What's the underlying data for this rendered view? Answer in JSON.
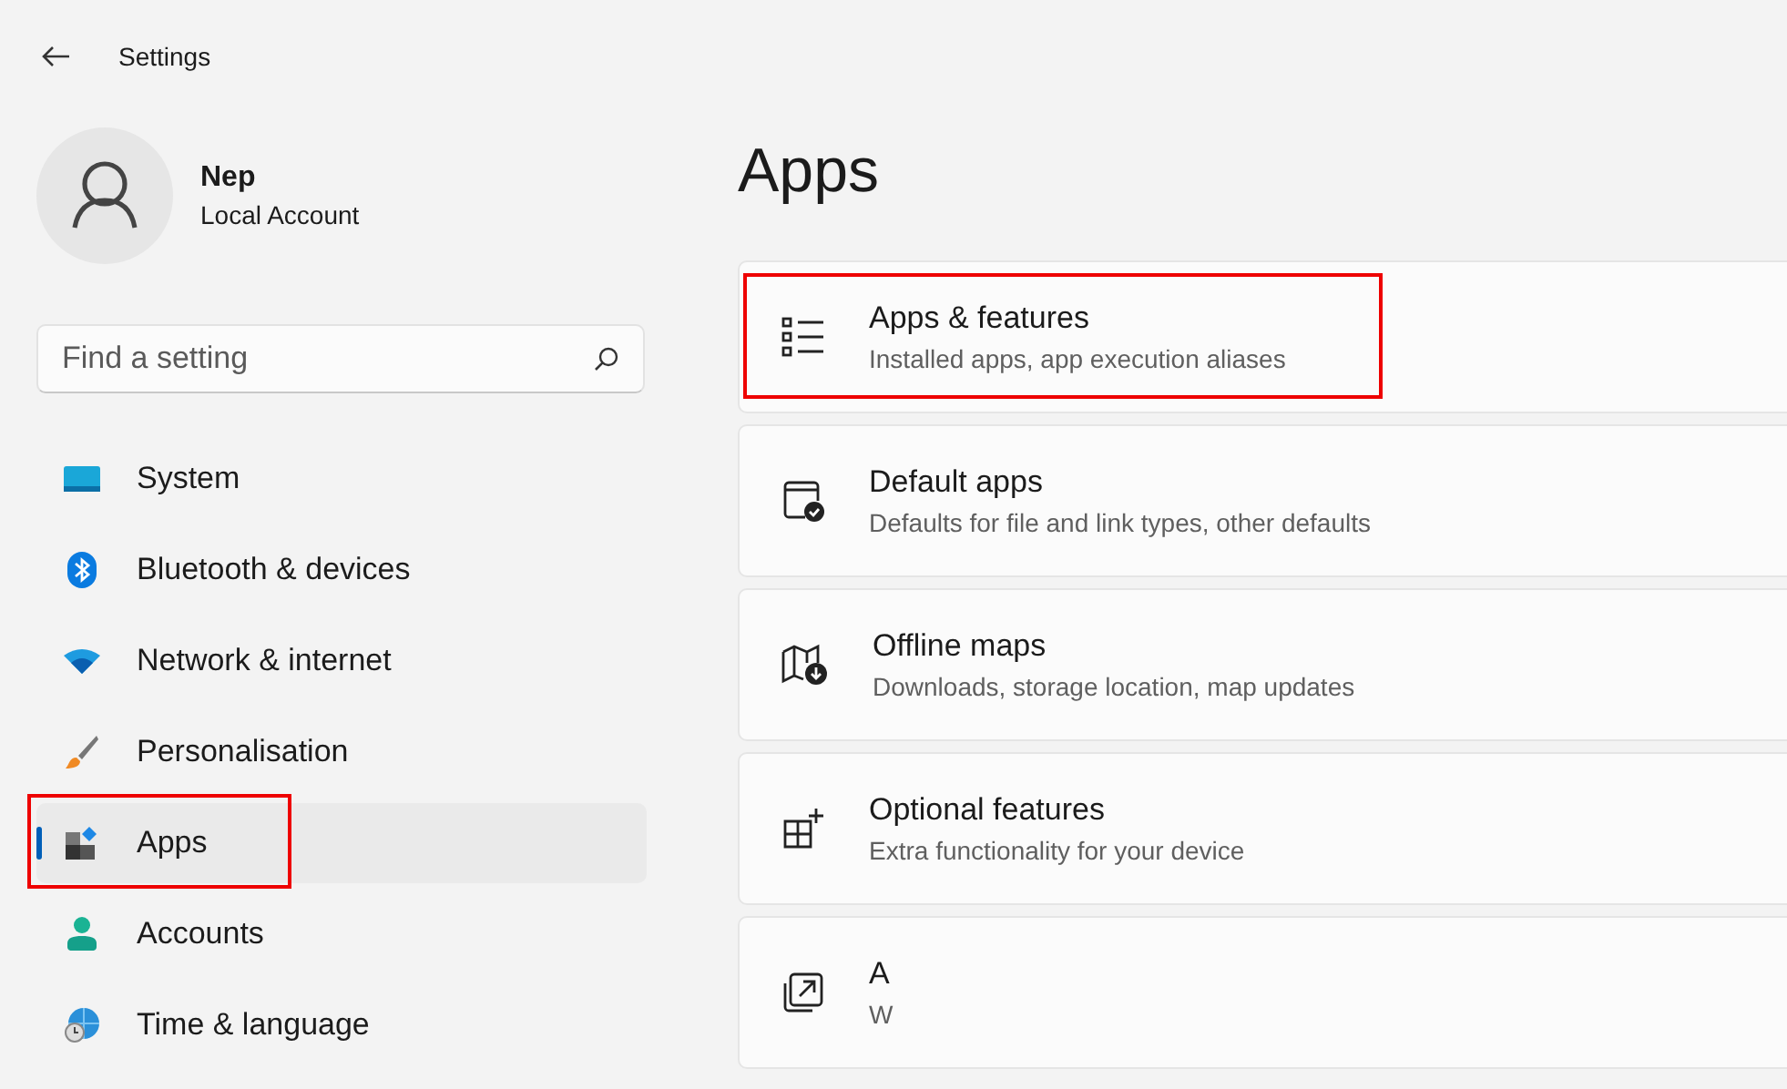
{
  "window": {
    "title": "Settings"
  },
  "account": {
    "name": "Nep",
    "type": "Local Account"
  },
  "search": {
    "placeholder": "Find a setting"
  },
  "sidebar": {
    "items": [
      {
        "label": "System",
        "kind": "system",
        "selected": false,
        "highlighted": false
      },
      {
        "label": "Bluetooth & devices",
        "kind": "bluetooth",
        "selected": false,
        "highlighted": false
      },
      {
        "label": "Network & internet",
        "kind": "network",
        "selected": false,
        "highlighted": false
      },
      {
        "label": "Personalisation",
        "kind": "brush",
        "selected": false,
        "highlighted": false
      },
      {
        "label": "Apps",
        "kind": "apps",
        "selected": true,
        "highlighted": true
      },
      {
        "label": "Accounts",
        "kind": "person",
        "selected": false,
        "highlighted": false
      },
      {
        "label": "Time & language",
        "kind": "globe",
        "selected": false,
        "highlighted": false
      }
    ]
  },
  "page": {
    "title": "Apps",
    "cards": [
      {
        "title": "Apps & features",
        "subtitle": "Installed apps, app execution aliases",
        "kind": "list",
        "highlighted": true
      },
      {
        "title": "Default apps",
        "subtitle": "Defaults for file and link types, other defaults",
        "kind": "default",
        "highlighted": false
      },
      {
        "title": "Offline maps",
        "subtitle": "Downloads, storage location, map updates",
        "kind": "map",
        "highlighted": false
      },
      {
        "title": "Optional features",
        "subtitle": "Extra functionality for your device",
        "kind": "optional",
        "highlighted": false
      },
      {
        "title": "A",
        "subtitle": "W",
        "kind": "open",
        "highlighted": false
      }
    ]
  }
}
